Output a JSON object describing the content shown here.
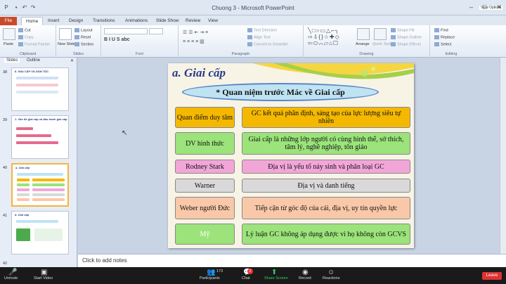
{
  "window": {
    "title": "Chuong 3 - Microsoft PowerPoint",
    "zoom_chip": "View Options"
  },
  "tabs": [
    "File",
    "Home",
    "Insert",
    "Design",
    "Transitions",
    "Animations",
    "Slide Show",
    "Review",
    "View"
  ],
  "ribbon": {
    "clipboard": {
      "label": "Clipboard",
      "paste": "Paste",
      "cut": "Cut",
      "copy": "Copy",
      "format_painter": "Format Painter"
    },
    "slides": {
      "label": "Slides",
      "new_slide": "New Slide",
      "layout": "Layout",
      "reset": "Reset",
      "section": "Section"
    },
    "font": {
      "label": "Font"
    },
    "paragraph": {
      "label": "Paragraph",
      "text_direction": "Text Direction",
      "align_text": "Align Text",
      "smartart": "Convert to SmartArt"
    },
    "drawing": {
      "label": "Drawing",
      "arrange": "Arrange",
      "quick_styles": "Quick Styles",
      "shape_fill": "Shape Fill",
      "shape_outline": "Shape Outline",
      "shape_effects": "Shape Effects"
    },
    "editing": {
      "label": "Editing",
      "find": "Find",
      "replace": "Replace",
      "select": "Select"
    }
  },
  "pane": {
    "slides_tab": "Slides",
    "outline_tab": "Outline",
    "thumbs": [
      {
        "num": "38",
        "title": "II. GIAI CẤP VÀ DÂN TỘC"
      },
      {
        "num": "39",
        "title": "1. Vấn đề giai cấp và đấu tranh giai cấp"
      },
      {
        "num": "40",
        "title": "a. Giai cấp"
      },
      {
        "num": "41",
        "title": "b. Giai cấp"
      },
      {
        "num": "42",
        "title": ""
      }
    ]
  },
  "slide": {
    "title": "a. Giai cấp",
    "banner": "* Quan niệm trước Mác về Giai cấp",
    "rows": [
      {
        "left": "Quan điểm duy tâm",
        "right": "GC kết quả phân định, sáng tạo của lực lượng siêu tự nhiên",
        "lcolor": "#f5b800",
        "rcolor": "#f5b800"
      },
      {
        "left": "DV hình thức",
        "right": "Giai cấp là những lớp người có cùng hình thể, sở thích, tâm lý, nghề nghiệp, tôn giáo",
        "lcolor": "#9be37a",
        "rcolor": "#9be37a"
      },
      {
        "left": "Rodney Stark",
        "right": "Địa vị là yếu tố nảy sinh và phân loại GC",
        "lcolor": "#f2a6d8",
        "rcolor": "#f2a6d8"
      },
      {
        "left": "Warner",
        "right": "Địa vị và danh tiếng",
        "lcolor": "#d9d9d9",
        "rcolor": "#d9d9d9"
      },
      {
        "left": "Weber người Đức",
        "right": "Tiếp cận từ góc độ của cải, địa vị, uy tín quyền lực",
        "lcolor": "#f9c8a8",
        "rcolor": "#f9c8a8"
      },
      {
        "left": "Mỹ",
        "right": "Lý luận GC không áp dụng được vì họ không còn GCVS",
        "lcolor": "#9be37a",
        "rcolor": "#9be37a"
      }
    ]
  },
  "notes": "Click to add notes",
  "zoom": {
    "participants_count": "173",
    "chat_badge": "2",
    "buttons": [
      "Unmute",
      "Start Video",
      "Participants",
      "Chat",
      "Share Screen",
      "Record",
      "Reactions"
    ],
    "end": "Leave"
  }
}
